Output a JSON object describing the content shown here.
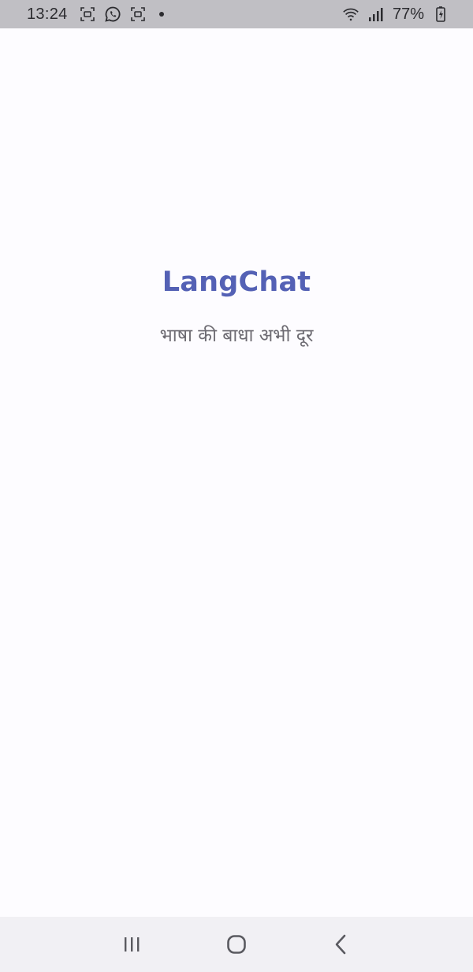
{
  "status_bar": {
    "time": "13:24",
    "left_icons": [
      "screenshot-icon",
      "whatsapp-icon",
      "screenshot-icon",
      "notification-dot"
    ],
    "right_icons": [
      "wifi-icon",
      "signal-icon",
      "battery-icon"
    ],
    "battery_percent": "77%"
  },
  "app": {
    "title": "LangChat",
    "tagline": "भाषा की बाधा अभी दूर",
    "title_color": "#5461b5",
    "tagline_color": "#6d6b72",
    "background": "#fdfcff"
  },
  "nav_bar": {
    "buttons": [
      "recent-apps-icon",
      "home-icon",
      "back-icon"
    ]
  }
}
